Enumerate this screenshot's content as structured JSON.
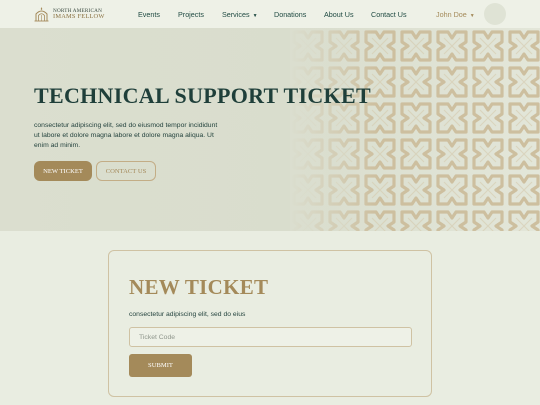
{
  "header": {
    "logo_line1": "NORTH AMERICAN",
    "logo_line2": "IMAMS FELLOW",
    "nav": {
      "events": "Events",
      "projects": "Projects",
      "services": "Services",
      "donations": "Donations",
      "about": "About Us",
      "contact": "Contact Us"
    },
    "user_name": "John Doe"
  },
  "hero": {
    "title": "TECHNICAL SUPPORT TICKET",
    "description": "consectetur adipiscing elit, sed do eiusmod tempor incididunt ut labore et dolore magna labore et dolore magna aliqua. Ut enim ad minim.",
    "new_ticket_label": "NEW TICKET",
    "contact_us_label": "CONTACT US"
  },
  "ticket_form": {
    "title": "NEW TICKET",
    "description": "consectetur adipiscing elit, sed do eius",
    "input_placeholder": "Ticket Code",
    "input_value": "",
    "submit_label": "SUBMIT"
  },
  "colors": {
    "accent": "#a48a5a",
    "text": "#1f3f3a",
    "background": "#e9ede1",
    "hero_background": "#dbdecf",
    "pattern": "#cdbf9f"
  },
  "icons": {
    "logo": "mosque-logo-icon",
    "dropdown": "caret-down-icon",
    "avatar": "user-avatar"
  }
}
